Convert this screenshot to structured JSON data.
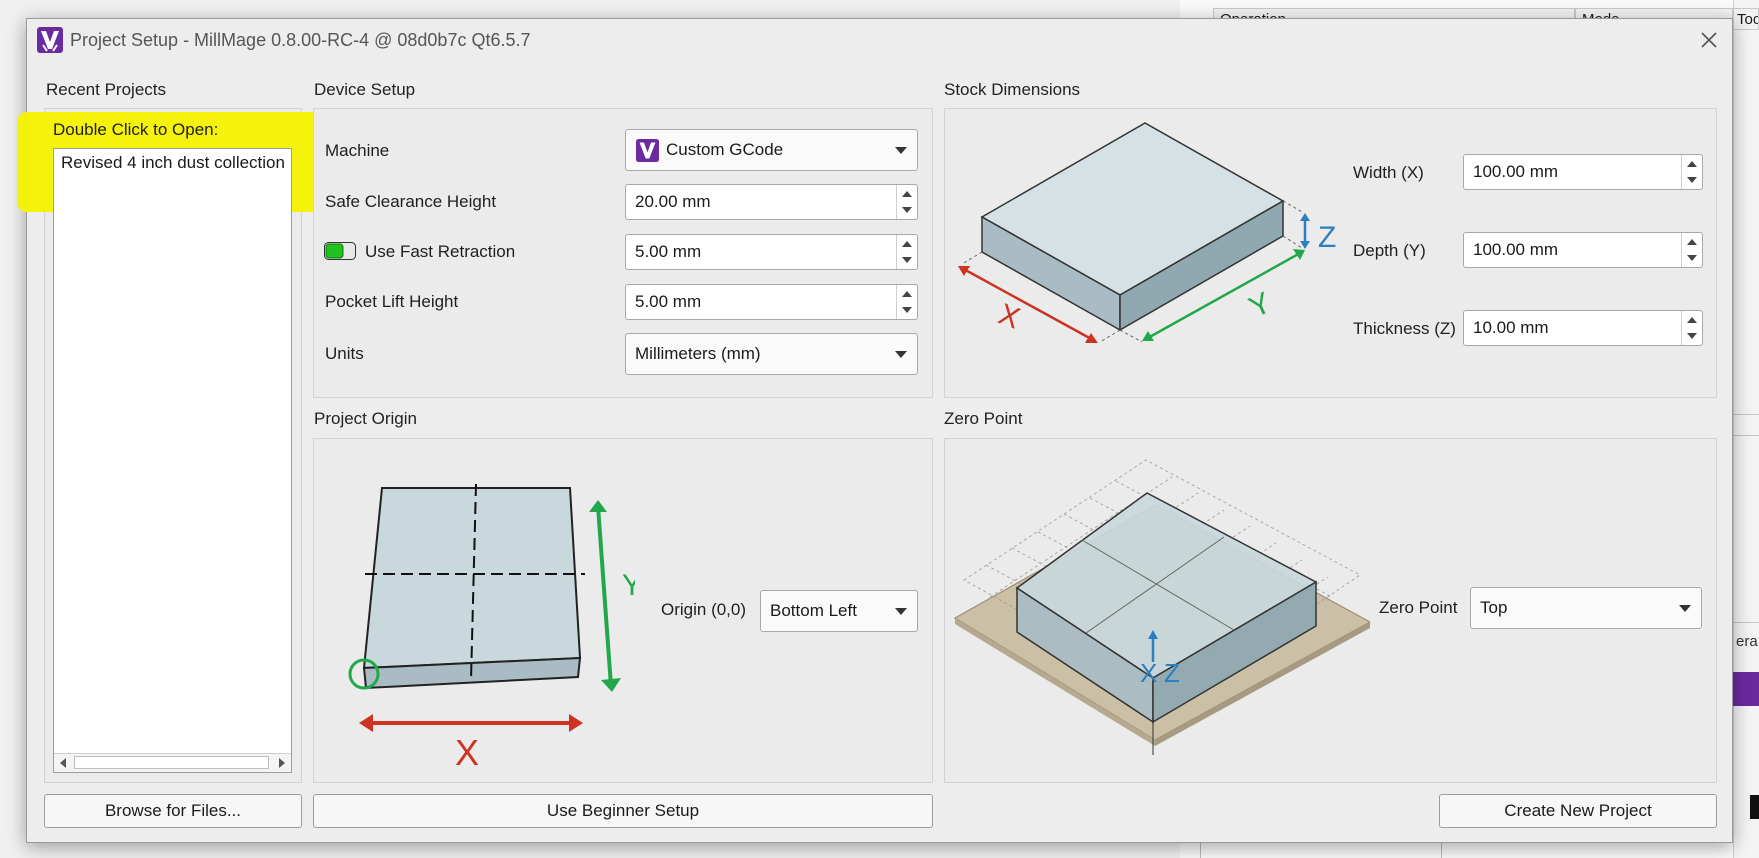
{
  "window": {
    "title": "Project Setup - MillMage 0.8.00-RC-4 @ 08d0b7c Qt6.5.7",
    "logo_icon": "millmage-logo-icon",
    "close_icon": "close-icon"
  },
  "background": {
    "headers": [
      "Operation",
      "Mode",
      "Too"
    ],
    "side_label": "erat"
  },
  "recent_projects": {
    "label": "Recent Projects",
    "hint": "Double Click to Open:",
    "items": [
      "Revised 4 inch dust collection"
    ],
    "browse_label": "Browse for Files..."
  },
  "device_setup": {
    "label": "Device Setup",
    "machine": {
      "label": "Machine",
      "value": "Custom GCode",
      "icon": "custom-gcode-icon"
    },
    "safe_clearance": {
      "label": "Safe Clearance Height",
      "value": "20.00 mm"
    },
    "fast_retraction": {
      "label": "Use Fast Retraction",
      "value": "5.00 mm",
      "enabled": true
    },
    "pocket_lift": {
      "label": "Pocket Lift Height",
      "value": "5.00 mm"
    },
    "units": {
      "label": "Units",
      "value": "Millimeters (mm)"
    },
    "beginner_label": "Use Beginner Setup"
  },
  "stock_dimensions": {
    "label": "Stock Dimensions",
    "width": {
      "label": "Width (X)",
      "value": "100.00 mm"
    },
    "depth": {
      "label": "Depth (Y)",
      "value": "100.00 mm"
    },
    "thickness": {
      "label": "Thickness (Z)",
      "value": "10.00 mm"
    },
    "axis_x": "X",
    "axis_y": "Y",
    "axis_z": "Z"
  },
  "project_origin": {
    "label": "Project Origin",
    "origin": {
      "label": "Origin (0,0)",
      "value": "Bottom Left"
    },
    "axis_x": "X",
    "axis_y": "Y"
  },
  "zero_point": {
    "label": "Zero Point",
    "zero": {
      "label": "Zero Point",
      "value": "Top"
    },
    "axis_x": "X",
    "axis_z": "Z"
  },
  "create_label": "Create New Project",
  "colors": {
    "accent_red": "#cc3322",
    "accent_green": "#22a84a",
    "accent_blue": "#2a7fc0",
    "highlight": "#f6f200",
    "stock_fill": "#c9d8dd",
    "brand_purple": "#6a2aa0"
  }
}
